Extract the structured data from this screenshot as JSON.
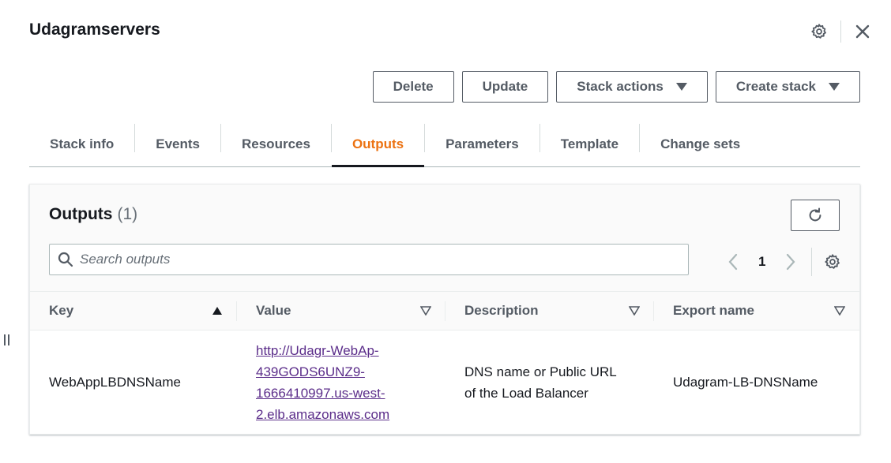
{
  "header": {
    "title": "Udagramservers"
  },
  "actions": {
    "delete": "Delete",
    "update": "Update",
    "stack_actions": "Stack actions",
    "create_stack": "Create stack"
  },
  "tabs": [
    {
      "label": "Stack info"
    },
    {
      "label": "Events"
    },
    {
      "label": "Resources"
    },
    {
      "label": "Outputs"
    },
    {
      "label": "Parameters"
    },
    {
      "label": "Template"
    },
    {
      "label": "Change sets"
    }
  ],
  "active_tab": "Outputs",
  "outputs": {
    "title": "Outputs",
    "count": "(1)",
    "search_placeholder": "Search outputs",
    "page": "1",
    "columns": {
      "key": "Key",
      "value": "Value",
      "description": "Description",
      "export": "Export name"
    },
    "rows": [
      {
        "key": "WebAppLBDNSName",
        "value_lines": [
          "http://Udagr-WebAp-",
          "439GODS6UNZ9-",
          "1666410997.us-west-",
          "2.elb.amazonaws.com"
        ],
        "description_lines": [
          "DNS name or Public URL",
          "of the Load Balancer"
        ],
        "export": "Udagram-LB-DNSName"
      }
    ]
  },
  "colors": {
    "accent": "#ec7211",
    "link": "#5b2d8a",
    "text": "#16191f",
    "muted": "#545b64"
  },
  "icons": {
    "settings": "gear-icon",
    "close": "close-icon",
    "refresh": "refresh-icon",
    "search": "search-icon"
  }
}
